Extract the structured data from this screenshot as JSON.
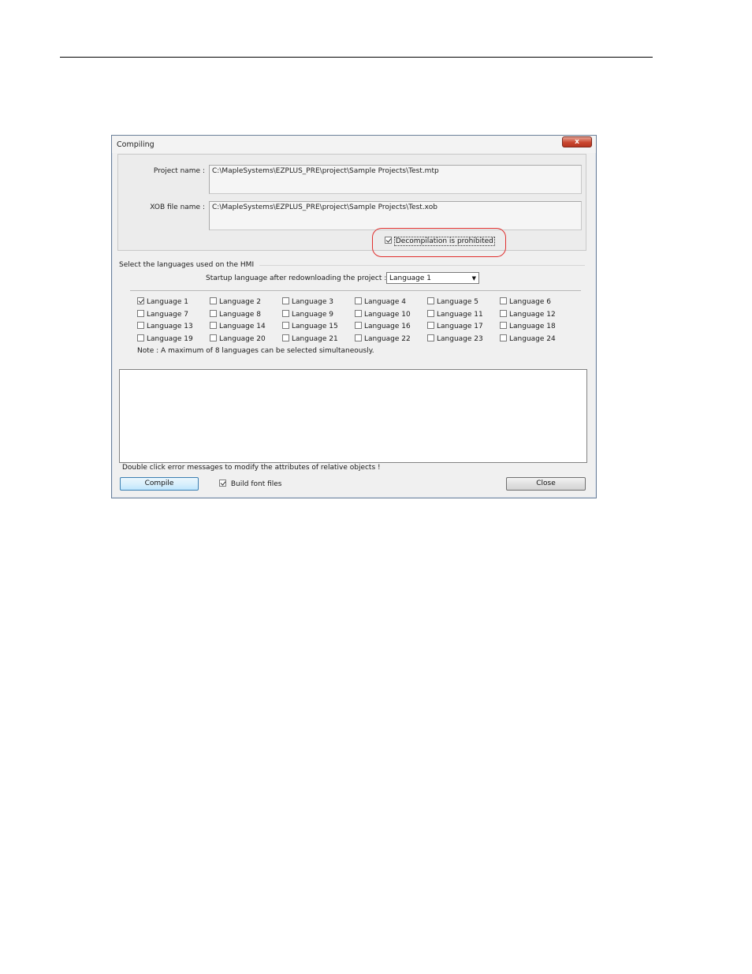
{
  "dialog": {
    "title": "Compiling",
    "close_glyph": "x",
    "project_name_label": "Project name :",
    "project_name_value": "C:\\MapleSystems\\EZPLUS_PRE\\project\\Sample Projects\\Test.mtp",
    "xob_file_label": "XOB file name :",
    "xob_file_value": "C:\\MapleSystems\\EZPLUS_PRE\\project\\Sample Projects\\Test.xob",
    "decompilation_label": "Decompilation is prohibited",
    "decompilation_checked": true,
    "languages_group_title": "Select the languages used on the HMI",
    "startup_language_label": "Startup language after redownloading the project :",
    "startup_language_value": "Language 1",
    "languages": [
      {
        "label": "Language 1",
        "checked": true
      },
      {
        "label": "Language 2",
        "checked": false
      },
      {
        "label": "Language 3",
        "checked": false
      },
      {
        "label": "Language 4",
        "checked": false
      },
      {
        "label": "Language 5",
        "checked": false
      },
      {
        "label": "Language 6",
        "checked": false
      },
      {
        "label": "Language 7",
        "checked": false
      },
      {
        "label": "Language 8",
        "checked": false
      },
      {
        "label": "Language 9",
        "checked": false
      },
      {
        "label": "Language 10",
        "checked": false
      },
      {
        "label": "Language 11",
        "checked": false
      },
      {
        "label": "Language 12",
        "checked": false
      },
      {
        "label": "Language 13",
        "checked": false
      },
      {
        "label": "Language 14",
        "checked": false
      },
      {
        "label": "Language 15",
        "checked": false
      },
      {
        "label": "Language 16",
        "checked": false
      },
      {
        "label": "Language 17",
        "checked": false
      },
      {
        "label": "Language 18",
        "checked": false
      },
      {
        "label": "Language 19",
        "checked": false
      },
      {
        "label": "Language 20",
        "checked": false
      },
      {
        "label": "Language 21",
        "checked": false
      },
      {
        "label": "Language 22",
        "checked": false
      },
      {
        "label": "Language 23",
        "checked": false
      },
      {
        "label": "Language 24",
        "checked": false
      }
    ],
    "note": "Note : A maximum of 8 languages can be selected simultaneously.",
    "hint": "Double click error messages to modify the attributes of relative objects !",
    "compile_button": "Compile",
    "build_font_label": "Build font files",
    "build_font_checked": true,
    "close_button": "Close"
  }
}
